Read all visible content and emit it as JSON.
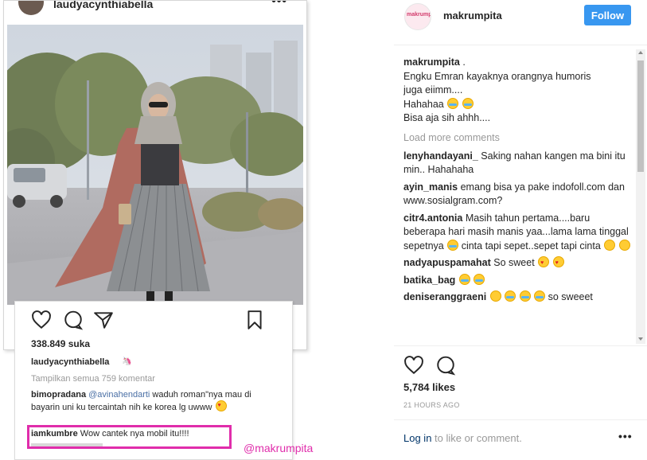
{
  "left_screenshot": {
    "username": "laudyacynthiabella",
    "likes": "338.849 suka",
    "caption_user": "laudyacynthiabella",
    "caption_emoji": "🦄",
    "view_all_comments": "Tampilkan semua 759 komentar",
    "comments": [
      {
        "author": "bimopradana",
        "mention": "@avinahendarti",
        "text": "waduh roman\"nya mau di bayarin uni ku tercaintah nih ke korea lg uwww"
      },
      {
        "author": "iamkumbre",
        "text": "Wow cantek nya mobil itu!!!!"
      }
    ],
    "watermark": "@makrumpita",
    "highlight_color": "#e02dab"
  },
  "side_panel": {
    "username": "makrumpita",
    "avatar_text": "makrumpita",
    "follow_label": "Follow",
    "follow_color": "#3897f0",
    "caption": {
      "author": "makrumpita",
      "author_suffix": ".",
      "lines": [
        "Engku Emran kayaknya orangnya humoris",
        "juga eiimm....",
        "Hahahaa",
        "Bisa aja sih ahhh...."
      ]
    },
    "load_more": "Load more comments",
    "comments": [
      {
        "author": "lenyhandayani_",
        "text": "Saking nahan kangen ma bini itu min.. Hahahaha"
      },
      {
        "author": "ayin_manis",
        "text": "emang bisa ya pake indofoll.com dan www.sosialgram.com?"
      },
      {
        "author": "citr4.antonia",
        "text": "Masih tahun pertama....baru beberapa hari masih manis yaa...lama lama tinggal sepetnya",
        "text2": "cinta tapi sepet..sepet tapi cinta"
      },
      {
        "author": "nadyapuspamahat",
        "text": "So sweet"
      },
      {
        "author": "batika_bag",
        "text": ""
      },
      {
        "author": "deniseranggraeni",
        "text": "so sweeet"
      }
    ],
    "likes": "5,784 likes",
    "time": "21 HOURS AGO",
    "login_link": "Log in",
    "login_rest": "to like or comment.",
    "more_dots": "•••"
  }
}
